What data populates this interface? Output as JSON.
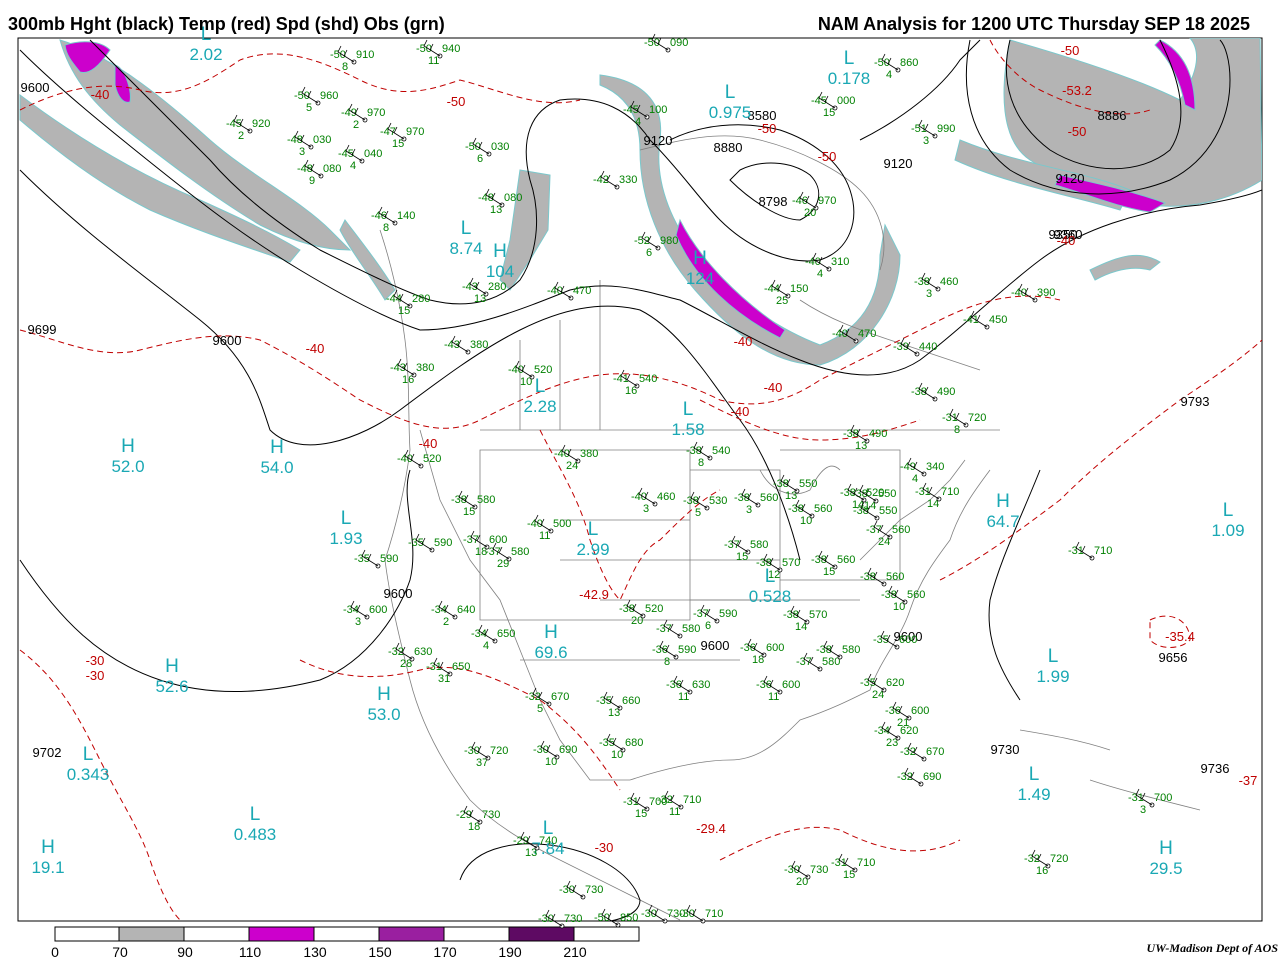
{
  "header": {
    "title": "300mb Hght (black) Temp (red) Spd (shd) Obs (grn)",
    "valid": "NAM Analysis for 1200 UTC Thursday  SEP 18 2025"
  },
  "colors": {
    "height_contour": "#000000",
    "temp_contour": "#c00000",
    "speed_70_90": "#b4b4b4",
    "speed_110_130": "#cc00cc",
    "speed_150_170": "#9a1fa0",
    "speed_190_210": "#5e0a63",
    "obs": "#008000",
    "extrema": "#1aa8b4",
    "map_lines": "#808080"
  },
  "legend": {
    "ticks": [
      "0",
      "70",
      "90",
      "110",
      "130",
      "150",
      "170",
      "190",
      "210"
    ]
  },
  "credit": "UW-Madison   Dept of AOS",
  "height_labels": [
    "9600",
    "9120",
    "8880",
    "8580",
    "8798",
    "8886",
    "9120",
    "9360",
    "9350",
    "9120",
    "9699",
    "9600",
    "9600",
    "9600",
    "9656",
    "9702",
    "9793",
    "9730",
    "9736",
    "9600"
  ],
  "temp_labels": [
    "-40",
    "-50",
    "-40",
    "-50",
    "-50",
    "-40",
    "-40",
    "-40",
    "-40",
    "-50",
    "-50",
    "-53.2",
    "-40",
    "-30",
    "-30",
    "-42.9",
    "-29.4",
    "-35.4",
    "-30",
    "-37"
  ],
  "extrema": [
    {
      "letter": "H",
      "value": "52.0"
    },
    {
      "letter": "H",
      "value": "54.0"
    },
    {
      "letter": "L",
      "value": "1.93"
    },
    {
      "letter": "H",
      "value": "52.6"
    },
    {
      "letter": "H",
      "value": "53.0"
    },
    {
      "letter": "L",
      "value": "0.343"
    },
    {
      "letter": "L",
      "value": "0.483"
    },
    {
      "letter": "H",
      "value": "19.1"
    },
    {
      "letter": "L",
      "value": "2.28"
    },
    {
      "letter": "L",
      "value": "2.99"
    },
    {
      "letter": "H",
      "value": "69.6"
    },
    {
      "letter": "L",
      "value": "1.58"
    },
    {
      "letter": "L",
      "value": "0.528"
    },
    {
      "letter": "H",
      "value": "64.7"
    },
    {
      "letter": "L",
      "value": "1.09"
    },
    {
      "letter": "L",
      "value": "1.99"
    },
    {
      "letter": "L",
      "value": "1.49"
    },
    {
      "letter": "H",
      "value": "29.5"
    },
    {
      "letter": "L",
      "value": "0.178"
    },
    {
      "letter": "L",
      "value": "0.975"
    },
    {
      "letter": "L",
      "value": "8.74"
    },
    {
      "letter": "H",
      "value": "104"
    },
    {
      "letter": "H",
      "value": "124"
    },
    {
      "letter": "L",
      "value": "2.02"
    },
    {
      "letter": "L",
      "value": "7.84"
    }
  ],
  "observations": [
    {
      "t": "-50",
      "h": "910",
      "dd": "8"
    },
    {
      "t": "-50",
      "h": "940",
      "dd": "11"
    },
    {
      "t": "-50",
      "h": "960",
      "dd": "5"
    },
    {
      "t": "-49",
      "h": "970",
      "dd": "2"
    },
    {
      "t": "-47",
      "h": "970",
      "dd": "15"
    },
    {
      "t": "-45",
      "h": "920",
      "dd": "2"
    },
    {
      "t": "-48",
      "h": "030",
      "dd": "3"
    },
    {
      "t": "-45",
      "h": "040",
      "dd": "4"
    },
    {
      "t": "-48",
      "h": "080",
      "dd": "9"
    },
    {
      "t": "-50",
      "h": "030",
      "dd": "6"
    },
    {
      "t": "-48",
      "h": "080",
      "dd": "13"
    },
    {
      "t": "-46",
      "h": "140",
      "dd": "8"
    },
    {
      "t": "-44",
      "h": "280",
      "dd": "15"
    },
    {
      "t": "-43",
      "h": "280",
      "dd": "13"
    },
    {
      "t": "-40",
      "h": "470",
      "dd": ""
    },
    {
      "t": "-43",
      "h": "380",
      "dd": ""
    },
    {
      "t": "-43",
      "h": "380",
      "dd": "16"
    },
    {
      "t": "-40",
      "h": "520",
      "dd": "10"
    },
    {
      "t": "-41",
      "h": "540",
      "dd": "16"
    },
    {
      "t": "-40",
      "h": "380",
      "dd": "24"
    },
    {
      "t": "-40",
      "h": "520",
      "dd": ""
    },
    {
      "t": "-38",
      "h": "580",
      "dd": "15"
    },
    {
      "t": "-40",
      "h": "500",
      "dd": "11"
    },
    {
      "t": "-37",
      "h": "600",
      "dd": "18"
    },
    {
      "t": "-35",
      "h": "590",
      "dd": ""
    },
    {
      "t": "-35",
      "h": "590",
      "dd": ""
    },
    {
      "t": "-37",
      "h": "580",
      "dd": "29"
    },
    {
      "t": "-34",
      "h": "600",
      "dd": "3"
    },
    {
      "t": "-34",
      "h": "640",
      "dd": "2"
    },
    {
      "t": "-34",
      "h": "650",
      "dd": "4"
    },
    {
      "t": "-32",
      "h": "630",
      "dd": "28"
    },
    {
      "t": "-31",
      "h": "650",
      "dd": "31"
    },
    {
      "t": "-32",
      "h": "670",
      "dd": "5"
    },
    {
      "t": "-38",
      "h": "540",
      "dd": "8"
    },
    {
      "t": "-40",
      "h": "460",
      "dd": "3"
    },
    {
      "t": "-38",
      "h": "530",
      "dd": "5"
    },
    {
      "t": "-38",
      "h": "560",
      "dd": "3"
    },
    {
      "t": "-38",
      "h": "550",
      "dd": "13"
    },
    {
      "t": "-38",
      "h": "560",
      "dd": "10"
    },
    {
      "t": "-37",
      "h": "580",
      "dd": "15"
    },
    {
      "t": "-38",
      "h": "570",
      "dd": "12"
    },
    {
      "t": "-38",
      "h": "560",
      "dd": "15"
    },
    {
      "t": "-38",
      "h": "520",
      "dd": "20"
    },
    {
      "t": "-37",
      "h": "580",
      "dd": ""
    },
    {
      "t": "-36",
      "h": "590",
      "dd": "8"
    },
    {
      "t": "-37",
      "h": "590",
      "dd": "6"
    },
    {
      "t": "-38",
      "h": "570",
      "dd": "14"
    },
    {
      "t": "-36",
      "h": "600",
      "dd": "18"
    },
    {
      "t": "-36",
      "h": "630",
      "dd": "11"
    },
    {
      "t": "-36",
      "h": "600",
      "dd": "11"
    },
    {
      "t": "-37",
      "h": "580",
      "dd": ""
    },
    {
      "t": "-38",
      "h": "580",
      "dd": ""
    },
    {
      "t": "-35",
      "h": "660",
      "dd": "13"
    },
    {
      "t": "-35",
      "h": "680",
      "dd": "10"
    },
    {
      "t": "-35",
      "h": "620",
      "dd": "24"
    },
    {
      "t": "-30",
      "h": "720",
      "dd": "37"
    },
    {
      "t": "-30",
      "h": "690",
      "dd": "10"
    },
    {
      "t": "-31",
      "h": "700",
      "dd": "15"
    },
    {
      "t": "-32",
      "h": "710",
      "dd": "11"
    },
    {
      "t": "-29",
      "h": "730",
      "dd": "18"
    },
    {
      "t": "-29",
      "h": "740",
      "dd": "13"
    },
    {
      "t": "-30",
      "h": "730",
      "dd": ""
    },
    {
      "t": "-30",
      "h": "730",
      "dd": ""
    },
    {
      "t": "-30",
      "h": "730",
      "dd": ""
    },
    {
      "t": "-30",
      "h": "710",
      "dd": ""
    },
    {
      "t": "-30",
      "h": "730",
      "dd": "20"
    },
    {
      "t": "-31",
      "h": "710",
      "dd": "15"
    },
    {
      "t": "-38",
      "h": "550",
      "dd": "14"
    },
    {
      "t": "-38",
      "h": "520",
      "dd": "14"
    },
    {
      "t": "-38",
      "h": "550",
      "dd": ""
    },
    {
      "t": "-37",
      "h": "560",
      "dd": "24"
    },
    {
      "t": "-38",
      "h": "560",
      "dd": ""
    },
    {
      "t": "-38",
      "h": "560",
      "dd": "10"
    },
    {
      "t": "-35",
      "h": "600",
      "dd": ""
    },
    {
      "t": "-36",
      "h": "600",
      "dd": "21"
    },
    {
      "t": "-34",
      "h": "620",
      "dd": "23"
    },
    {
      "t": "-32",
      "h": "670",
      "dd": ""
    },
    {
      "t": "-32",
      "h": "690",
      "dd": ""
    },
    {
      "t": "-31",
      "h": "710",
      "dd": ""
    },
    {
      "t": "-31",
      "h": "700",
      "dd": "3"
    },
    {
      "t": "-32",
      "h": "720",
      "dd": "16"
    },
    {
      "t": "-31",
      "h": "710",
      "dd": "14"
    },
    {
      "t": "-31",
      "h": "720",
      "dd": "8"
    },
    {
      "t": "-38",
      "h": "490",
      "dd": ""
    },
    {
      "t": "-38",
      "h": "490",
      "dd": "13"
    },
    {
      "t": "-39",
      "h": "440",
      "dd": ""
    },
    {
      "t": "-41",
      "h": "450",
      "dd": ""
    },
    {
      "t": "-40",
      "h": "390",
      "dd": ""
    },
    {
      "t": "-38",
      "h": "460",
      "dd": "3"
    },
    {
      "t": "-40",
      "h": "470",
      "dd": ""
    },
    {
      "t": "-40",
      "h": "310",
      "dd": "4"
    },
    {
      "t": "-44",
      "h": "150",
      "dd": "25"
    },
    {
      "t": "-46",
      "h": "970",
      "dd": "20"
    },
    {
      "t": "-45",
      "h": "000",
      "dd": "15"
    },
    {
      "t": "-50",
      "h": "860",
      "dd": "4"
    },
    {
      "t": "-51",
      "h": "990",
      "dd": "3"
    },
    {
      "t": "-52",
      "h": "980",
      "dd": "6"
    },
    {
      "t": "-45",
      "h": "100",
      "dd": "4"
    },
    {
      "t": "-42",
      "h": "330",
      "dd": ""
    },
    {
      "t": "-50",
      "h": "090",
      "dd": ""
    },
    {
      "t": "-49",
      "h": "340",
      "dd": "4"
    },
    {
      "t": "-50",
      "h": "850",
      "dd": ""
    },
    {
      "t": "-40",
      "h": "440",
      "dd": "5"
    },
    {
      "t": "-30",
      "h": "730",
      "dd": ""
    }
  ]
}
